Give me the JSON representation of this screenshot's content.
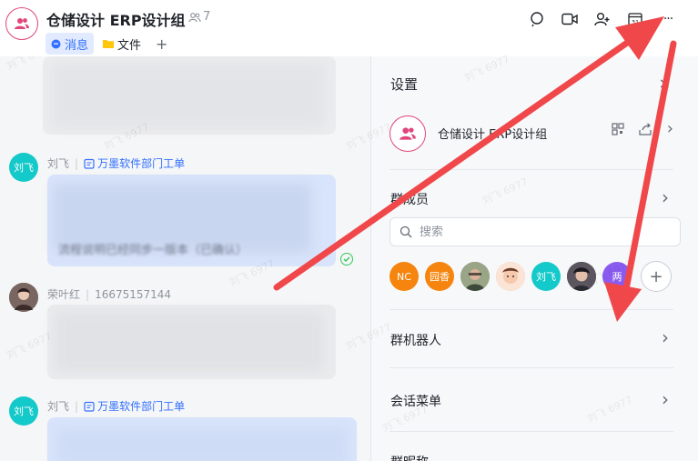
{
  "header": {
    "title": "仓储设计 ERP设计组",
    "member_count": "7",
    "tabs": [
      {
        "label": "消息"
      },
      {
        "label": "文件"
      }
    ],
    "add_tab": "+",
    "icons": [
      "search-chat-icon",
      "video-call-icon",
      "add-member-icon",
      "calendar-icon",
      "more-icon"
    ],
    "calendar_day": "31",
    "more": "···"
  },
  "chat": {
    "messages": [
      {
        "sender": "刘飞",
        "avatar_text": "刘飞",
        "avatar_color": "#14c9c9",
        "link": "万墨软件部门工单",
        "visible_text": "流程说明已经同步一版本（已确认）"
      },
      {
        "sender": "荣叶红",
        "phone": "16675157144"
      },
      {
        "sender": "刘飞",
        "avatar_text": "刘飞",
        "avatar_color": "#14c9c9",
        "link": "万墨软件部门工单"
      }
    ]
  },
  "settings": {
    "title": "设置",
    "close": "×",
    "group_name": "仓储设计 ERP设计组",
    "members_label": "群成员",
    "search_placeholder": "搜索",
    "members": [
      {
        "text": "NC",
        "color": "#f5850f"
      },
      {
        "text": "园香",
        "color": "#f5850f"
      },
      {
        "text": "",
        "color": "#7a8a6a"
      },
      {
        "text": "",
        "color": "#f2b8a0"
      },
      {
        "text": "刘飞",
        "color": "#14c9c9"
      },
      {
        "text": "",
        "color": "#4a4a55"
      },
      {
        "text": "两",
        "color": "#8a5bf0"
      }
    ],
    "add_member": "+",
    "bots_label": "群机器人",
    "menu_label": "会话菜单",
    "nickname_label": "群昵称",
    "chevron": "›"
  },
  "watermark": "刘飞 6977",
  "colors": {
    "accent": "#3370ff",
    "group_avatar": "#e0457b",
    "arrow": "#f0484a"
  }
}
